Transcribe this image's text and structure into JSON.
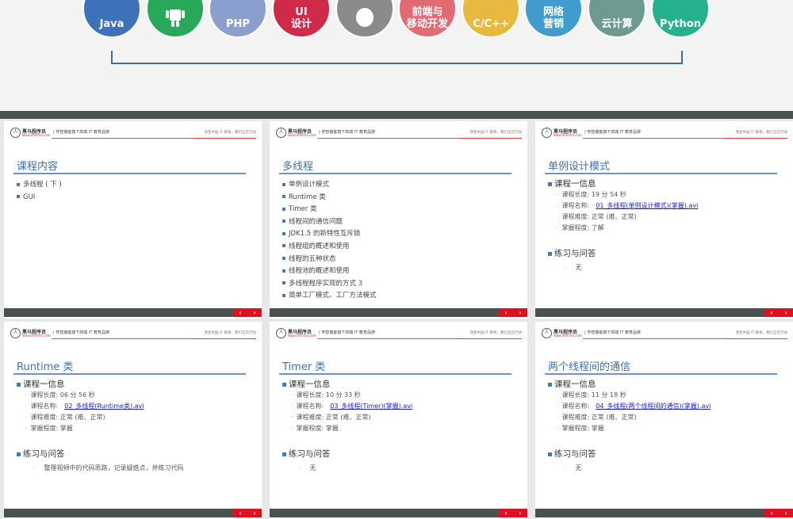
{
  "banner": {
    "tracks": [
      {
        "label": "Java",
        "color": "#3d72b9"
      },
      {
        "label": "",
        "icon": "android-icon",
        "color": "#2aa85a"
      },
      {
        "label": "PHP",
        "color": "#8b9fce"
      },
      {
        "label": "UI\n设计",
        "color": "#cf2a4a"
      },
      {
        "label": "",
        "icon": "apple-icon",
        "color": "#8a8a8a"
      },
      {
        "label": "前端与\n移动开发",
        "color": "#e06b72"
      },
      {
        "label": "C/C++",
        "color": "#e8b93f"
      },
      {
        "label": "网络\n营销",
        "color": "#3f9ccd"
      },
      {
        "label": "云计算",
        "color": "#6d9a8e"
      },
      {
        "label": "Python",
        "color": "#25b08e"
      }
    ]
  },
  "header": {
    "logo": "黑马程序员",
    "url": "www.itheima.com",
    "slogan": "| 传智播客旗下高端 IT 教育品牌",
    "motto": "改变中国 IT 教育，我们正在行动"
  },
  "nav": {
    "prev": "‹",
    "next": "›"
  },
  "slides": [
    {
      "title": "课程内容",
      "items": [
        "多线程 ( 下 )",
        "GUI"
      ]
    },
    {
      "title": "多线程",
      "items": [
        "单例设计模式",
        "Runtime 类",
        "Timer 类",
        "线程间的通信问题",
        "JDK1.5 的新特性互斥锁",
        "线程组的概述和使用",
        "线程的五种状态",
        "线程池的概述和使用",
        "多线程程序实现的方式 3",
        "简单工厂模式、工厂方法模式"
      ]
    },
    {
      "title": "单例设计模式",
      "section1": "课程一信息",
      "length": "课程长度:  19 分 54 秒",
      "name_label": "课程名称:",
      "file": "01_多线程(单例设计模式)(掌握).avi",
      "difficulty": "课程难度: 正常    (难、正常)",
      "mastery": "掌握程度: 了解",
      "section2": "练习与问答",
      "qa": "无"
    },
    {
      "title": "Runtime 类",
      "section1": "课程一信息",
      "length": "课程长度:  06 分 56 秒",
      "name_label": "课程名称:",
      "file": "02_多线程(Runtime类).avi",
      "difficulty": "课程难度: 正常    (难、正常)",
      "mastery": "掌握程度: 掌握",
      "section2": "练习与问答",
      "qa": "整理视频中的代码思路，记录疑惑点，并练习代码"
    },
    {
      "title": "Timer 类",
      "section1": "课程一信息",
      "length": "课程长度:  10 分 33 秒",
      "name_label": "课程名称:",
      "file": "03_多线程(Timer)(掌握).avi",
      "difficulty": "课程难度: 正常    (难、正常)",
      "mastery": "掌握程度: 掌握",
      "section2": "练习与问答",
      "qa": "无"
    },
    {
      "title": "两个线程间的通信",
      "section1": "课程一信息",
      "length": "课程长度:  11 分 18 秒",
      "name_label": "课程名称:",
      "file": "04_多线程(两个线程间的通信)(掌握).avi",
      "difficulty": "课程难度: 正常    (难、正常)",
      "mastery": "掌握程度: 掌握",
      "section2": "练习与问答",
      "qa": "无"
    }
  ]
}
